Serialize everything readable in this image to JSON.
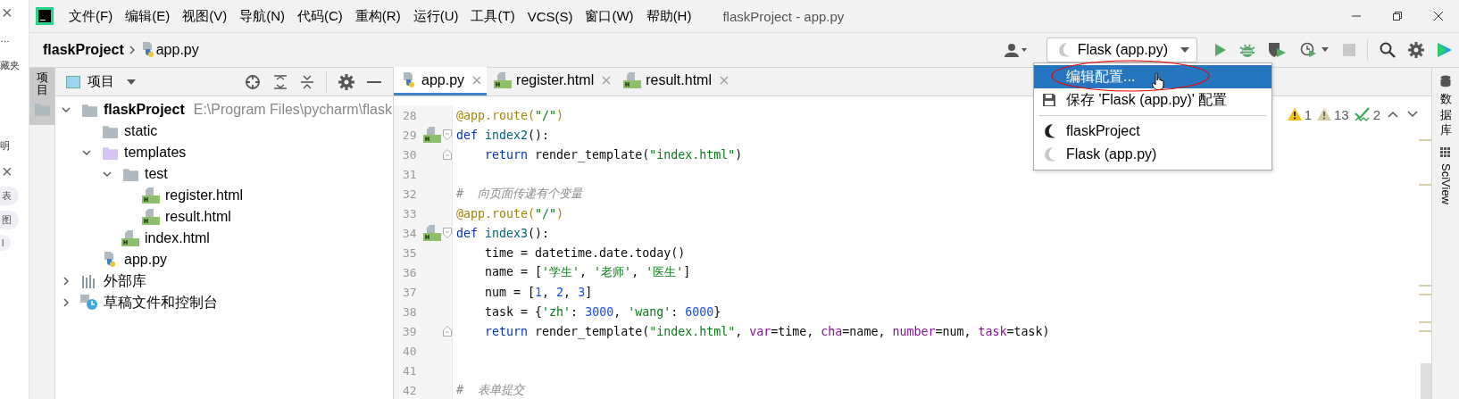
{
  "background_window": {
    "items": [
      {
        "kind": "close",
        "text": "×"
      },
      {
        "kind": "text",
        "text": "…"
      },
      {
        "kind": "text",
        "text": "藏夹"
      },
      {
        "kind": "gap"
      },
      {
        "kind": "text",
        "text": "明"
      },
      {
        "kind": "close",
        "text": "×"
      },
      {
        "kind": "pill",
        "text": "表"
      },
      {
        "kind": "pill",
        "text": "图"
      },
      {
        "kind": "pill",
        "text": "l"
      }
    ]
  },
  "menu_bar": {
    "items": [
      "文件(F)",
      "编辑(E)",
      "视图(V)",
      "导航(N)",
      "代码(C)",
      "重构(R)",
      "运行(U)",
      "工具(T)",
      "VCS(S)",
      "窗口(W)",
      "帮助(H)"
    ],
    "title": "flaskProject - app.py"
  },
  "breadcrumb": [
    "flaskProject",
    "app.py"
  ],
  "run_config": {
    "label": "Flask (app.py)"
  },
  "toolbar": {
    "stop_disabled": true
  },
  "project": {
    "title": "项目",
    "tree": [
      {
        "kind": "folder",
        "label": "flaskProject",
        "path": "E:\\Program Files\\pycharm\\flask",
        "expanded": true,
        "children": [
          {
            "kind": "folder",
            "label": "static"
          },
          {
            "kind": "template-folder",
            "label": "templates",
            "expanded": true,
            "children": [
              {
                "kind": "folder",
                "label": "test",
                "expanded": true,
                "children": [
                  {
                    "kind": "html",
                    "label": "register.html"
                  },
                  {
                    "kind": "html",
                    "label": "result.html"
                  }
                ]
              },
              {
                "kind": "html",
                "label": "index.html"
              }
            ]
          },
          {
            "kind": "py",
            "label": "app.py"
          }
        ]
      },
      {
        "kind": "library",
        "label": "外部库",
        "expanded": false
      },
      {
        "kind": "scratch",
        "label": "草稿文件和控制台",
        "expanded": false
      }
    ]
  },
  "left_stripe": {
    "tab": "项目"
  },
  "editor_tabs": [
    {
      "kind": "py",
      "label": "app.py",
      "selected": true
    },
    {
      "kind": "html",
      "label": "register.html",
      "selected": false
    },
    {
      "kind": "html",
      "label": "result.html",
      "selected": false
    }
  ],
  "code": [
    {
      "number": "28",
      "tokens": [
        {
          "kind": "decorator",
          "text": "@app.route("
        },
        {
          "kind": "string",
          "text": "\"/\""
        },
        {
          "kind": "decorator",
          "text": ")"
        }
      ]
    },
    {
      "number": "29",
      "html_icon": true,
      "fold_start": true,
      "tokens": [
        {
          "kind": "keyword",
          "text": "def "
        },
        {
          "kind": "func",
          "text": "index2"
        },
        {
          "kind": "plain",
          "text": "():"
        }
      ]
    },
    {
      "number": "30",
      "fold_end": true,
      "tokens": [
        {
          "kind": "keyword",
          "text": "    return "
        },
        {
          "kind": "plain",
          "text": "render_template("
        },
        {
          "kind": "string",
          "text": "\"index.html\""
        },
        {
          "kind": "plain",
          "text": ")"
        }
      ]
    },
    {
      "number": "31"
    },
    {
      "number": "32",
      "tokens": [
        {
          "kind": "comment",
          "text": "#  向页面传递有个变量"
        }
      ]
    },
    {
      "number": "33",
      "tokens": [
        {
          "kind": "decorator",
          "text": "@app.route("
        },
        {
          "kind": "string",
          "text": "\"/\""
        },
        {
          "kind": "decorator",
          "text": ")"
        }
      ]
    },
    {
      "number": "34",
      "html_icon": true,
      "fold_start": true,
      "tokens": [
        {
          "kind": "keyword",
          "text": "def "
        },
        {
          "kind": "func",
          "text": "index3"
        },
        {
          "kind": "plain",
          "text": "():"
        }
      ]
    },
    {
      "number": "35",
      "tokens": [
        {
          "kind": "plain",
          "text": "    time = datetime.date.today()"
        }
      ]
    },
    {
      "number": "36",
      "tokens": [
        {
          "kind": "plain",
          "text": "    name = ["
        },
        {
          "kind": "string",
          "text": "'学生'"
        },
        {
          "kind": "plain",
          "text": ", "
        },
        {
          "kind": "string",
          "text": "'老师'"
        },
        {
          "kind": "plain",
          "text": ", "
        },
        {
          "kind": "string",
          "text": "'医生'"
        },
        {
          "kind": "plain",
          "text": "]"
        }
      ]
    },
    {
      "number": "37",
      "tokens": [
        {
          "kind": "plain",
          "text": "    num = ["
        },
        {
          "kind": "number",
          "text": "1"
        },
        {
          "kind": "plain",
          "text": ", "
        },
        {
          "kind": "number",
          "text": "2"
        },
        {
          "kind": "plain",
          "text": ", "
        },
        {
          "kind": "number",
          "text": "3"
        },
        {
          "kind": "plain",
          "text": "]"
        }
      ]
    },
    {
      "number": "38",
      "tokens": [
        {
          "kind": "plain",
          "text": "    task = {"
        },
        {
          "kind": "string",
          "text": "'zh'"
        },
        {
          "kind": "plain",
          "text": ": "
        },
        {
          "kind": "number",
          "text": "3000"
        },
        {
          "kind": "plain",
          "text": ", "
        },
        {
          "kind": "string",
          "text": "'wang'"
        },
        {
          "kind": "plain",
          "text": ": "
        },
        {
          "kind": "number",
          "text": "6000"
        },
        {
          "kind": "plain",
          "text": "}"
        }
      ]
    },
    {
      "number": "39",
      "fold_end": true,
      "tokens": [
        {
          "kind": "keyword",
          "text": "    return "
        },
        {
          "kind": "plain",
          "text": "render_template("
        },
        {
          "kind": "string",
          "text": "\"index.html\""
        },
        {
          "kind": "plain",
          "text": ", "
        },
        {
          "kind": "param",
          "text": "var"
        },
        {
          "kind": "plain",
          "text": "=time, "
        },
        {
          "kind": "param",
          "text": "cha"
        },
        {
          "kind": "plain",
          "text": "=name, "
        },
        {
          "kind": "param",
          "text": "number"
        },
        {
          "kind": "plain",
          "text": "=num, "
        },
        {
          "kind": "param",
          "text": "task"
        },
        {
          "kind": "plain",
          "text": "=task)"
        }
      ]
    },
    {
      "number": "40"
    },
    {
      "number": "41"
    },
    {
      "number": "42",
      "tokens": [
        {
          "kind": "comment",
          "text": "#  表单提交"
        }
      ]
    }
  ],
  "inspections": [
    {
      "kind": "warning",
      "count": "1"
    },
    {
      "kind": "weak-warning",
      "count": "13"
    },
    {
      "kind": "typo",
      "count": "2"
    }
  ],
  "dropdown": {
    "items": [
      {
        "kind": "edit",
        "label": "编辑配置...",
        "selected": true
      },
      {
        "kind": "save",
        "label": "保存 'Flask (app.py)' 配置",
        "selected": false
      },
      {
        "kind": "separator"
      },
      {
        "kind": "project-config",
        "label": "flaskProject",
        "selected": false
      },
      {
        "kind": "temp-config",
        "label": "Flask (app.py)",
        "selected": false
      }
    ]
  },
  "right_stripe": [
    {
      "kind": "cjk",
      "label": "数据库"
    },
    {
      "kind": "latin",
      "label": "SciView"
    }
  ]
}
